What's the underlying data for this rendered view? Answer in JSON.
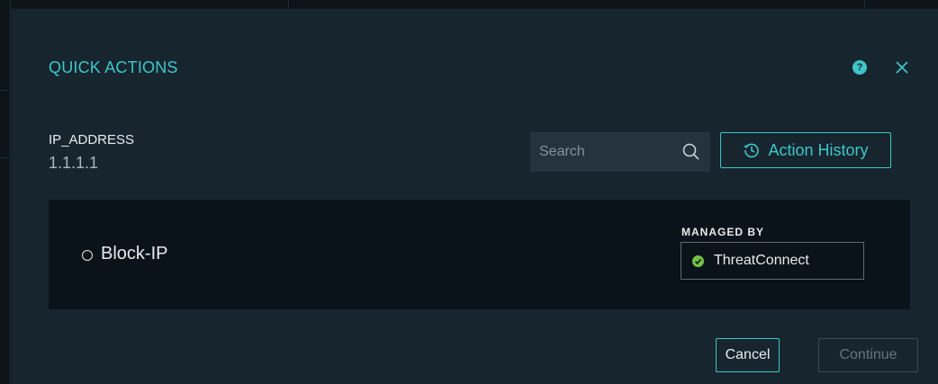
{
  "dialog": {
    "title": "QUICK ACTIONS",
    "help_icon": "question-circle-icon",
    "help_glyph": "?",
    "close_icon": "close-icon"
  },
  "field": {
    "label": "IP_ADDRESS",
    "value": "1.1.1.1"
  },
  "search": {
    "placeholder": "Search",
    "value": "",
    "icon": "search-icon"
  },
  "history_button": {
    "label": "Action History",
    "icon": "history-icon"
  },
  "actions": [
    {
      "name": "Block-IP",
      "selected": false,
      "managed_by_label": "MANAGED BY",
      "managed_by": "ThreatConnect",
      "managed_status_icon": "check-circle-icon"
    }
  ],
  "footer": {
    "cancel_label": "Cancel",
    "continue_label": "Continue",
    "continue_enabled": false
  },
  "colors": {
    "accent": "#3dc7c9",
    "status_ok": "#74c043",
    "dialog_bg": "#17252f",
    "panel_bg": "#0a1319"
  }
}
